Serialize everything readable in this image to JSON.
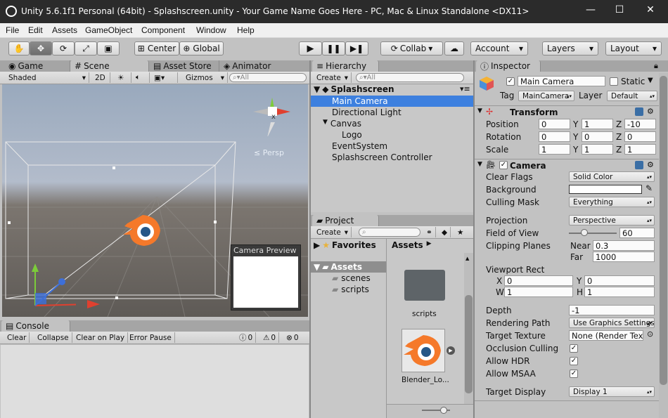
{
  "window": {
    "title": "Unity 5.6.1f1 Personal (64bit) - Splashscreen.unity - Your Game Name Goes Here - PC, Mac & Linux Standalone <DX11>",
    "min": "—",
    "max": "☐",
    "close": "✕"
  },
  "menu": [
    "File",
    "Edit",
    "Assets",
    "GameObject",
    "Component",
    "Window",
    "Help"
  ],
  "toolbar": {
    "center": "Center",
    "global": "Global",
    "collab": "Collab",
    "account": "Account",
    "layers": "Layers",
    "layout": "Layout"
  },
  "scene": {
    "tabs": [
      "Game",
      "Scene",
      "Asset Store",
      "Animator"
    ],
    "shaded": "Shaded",
    "mode2d": "2D",
    "gizmos": "Gizmos",
    "search_placeholder": "All",
    "persp": "≤ Persp",
    "camera_preview": "Camera Preview",
    "axis_x": "x"
  },
  "hierarchy": {
    "tab": "Hierarchy",
    "create": "Create",
    "search_placeholder": "All",
    "scene_name": "Splashscreen",
    "items": [
      "Main Camera",
      "Directional Light",
      "Canvas",
      "Logo",
      "EventSystem",
      "Splashscreen Controller"
    ]
  },
  "project": {
    "tab": "Project",
    "create": "Create",
    "favorites": "Favorites",
    "assets_tree": "Assets",
    "folders": [
      "scenes",
      "scripts"
    ],
    "breadcrumb": "Assets",
    "asset_items": [
      "scripts",
      "Blender_Lo..."
    ]
  },
  "console": {
    "tab": "Console",
    "buttons": [
      "Clear",
      "Collapse",
      "Clear on Play",
      "Error Pause"
    ],
    "counts": [
      "0",
      "0",
      "0"
    ]
  },
  "inspector": {
    "tab": "Inspector",
    "name": "Main Camera",
    "static": "Static",
    "tag_label": "Tag",
    "tag": "MainCamera",
    "layer_label": "Layer",
    "layer": "Default",
    "transform": {
      "title": "Transform",
      "rows": [
        {
          "label": "Position",
          "x": "0",
          "y": "1",
          "z": "-10"
        },
        {
          "label": "Rotation",
          "x": "0",
          "y": "0",
          "z": "0"
        },
        {
          "label": "Scale",
          "x": "1",
          "y": "1",
          "z": "1"
        }
      ]
    },
    "camera": {
      "title": "Camera",
      "clear_flags_label": "Clear Flags",
      "clear_flags": "Solid Color",
      "background_label": "Background",
      "background_color": "#ffffff",
      "culling_label": "Culling Mask",
      "culling": "Everything",
      "projection_label": "Projection",
      "projection": "Perspective",
      "fov_label": "Field of View",
      "fov": "60",
      "fov_fraction": 0.33,
      "clipping_label": "Clipping Planes",
      "near_label": "Near",
      "near": "0.3",
      "far_label": "Far",
      "far": "1000",
      "viewport_label": "Viewport Rect",
      "vx": "0",
      "vy": "0",
      "vw": "1",
      "vh": "1",
      "depth_label": "Depth",
      "depth": "-1",
      "rendering_label": "Rendering Path",
      "rendering": "Use Graphics Settings",
      "target_texture_label": "Target Texture",
      "target_texture": "None (Render Texture)",
      "occlusion_label": "Occlusion Culling",
      "hdr_label": "Allow HDR",
      "msaa_label": "Allow MSAA",
      "display_label": "Target Display",
      "display": "Display 1"
    }
  },
  "colors": {
    "selection": "#3d80df",
    "panel": "#c2c2c2",
    "titlebar": "#2b2b2b"
  }
}
